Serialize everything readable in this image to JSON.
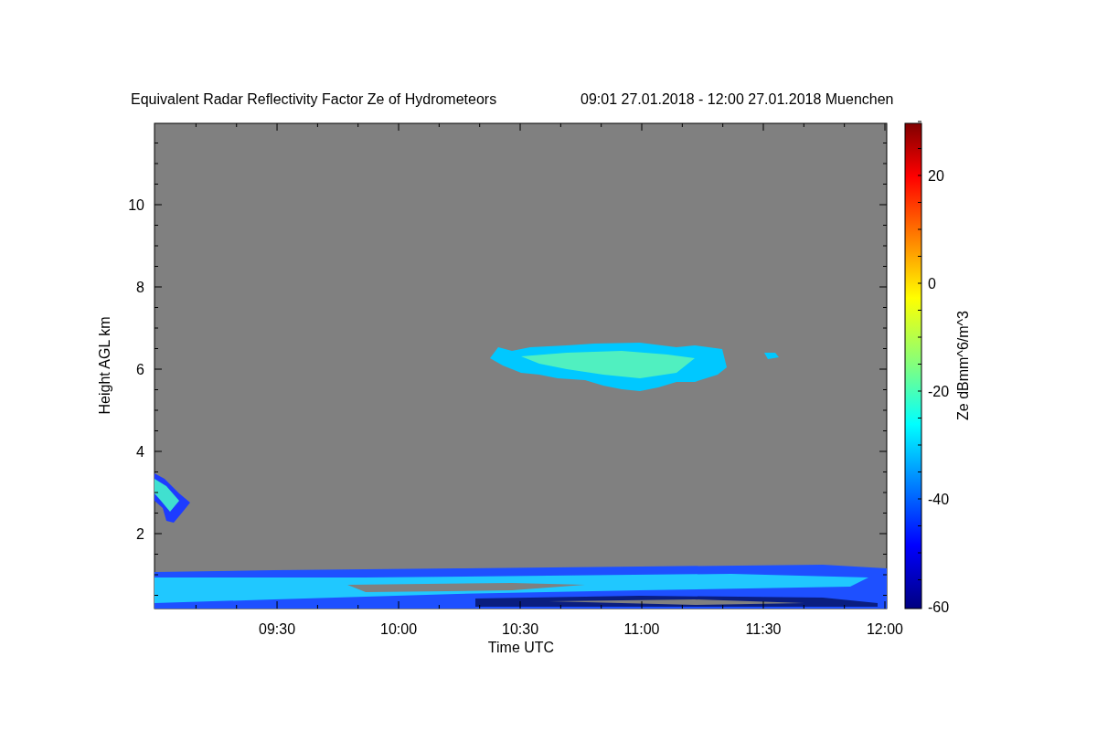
{
  "title": {
    "main": "Equivalent Radar Reflectivity Factor Ze of Hydrometeors",
    "period": "09:01 27.01.2018 - 12:00 27.01.2018 Muenchen"
  },
  "x_axis": {
    "label": "Time UTC",
    "ticks": [
      "09:30",
      "10:00",
      "10:30",
      "11:00",
      "11:30",
      "12:00"
    ]
  },
  "y_axis": {
    "label": "Height AGL km",
    "ticks": [
      "10",
      "8",
      "6",
      "4",
      "2"
    ]
  },
  "colorbar": {
    "label": "Ze dBmm^6/m^3",
    "ticks": [
      "20",
      "0",
      "-20",
      "-40",
      "-60"
    ]
  }
}
